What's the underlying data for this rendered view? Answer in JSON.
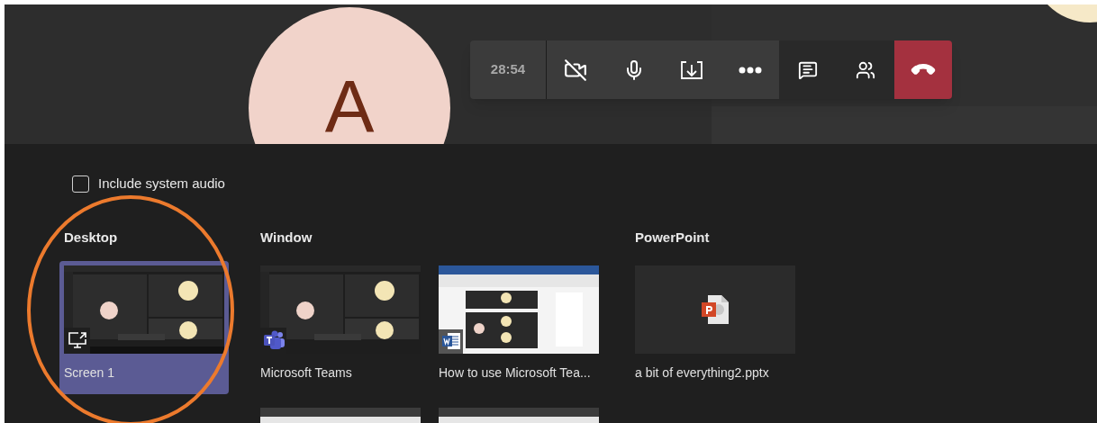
{
  "stage": {
    "avatar_initial": "A"
  },
  "call_toolbar": {
    "timer": "28:54",
    "camera_on": false,
    "mic_on": true
  },
  "share_panel": {
    "system_audio": {
      "label": "Include system audio",
      "checked": false
    },
    "sections": [
      {
        "title": "Desktop",
        "items": [
          {
            "kind": "screen",
            "label": "Screen 1",
            "selected": true
          }
        ]
      },
      {
        "title": "Window",
        "items": [
          {
            "kind": "teams",
            "label": "Microsoft Teams",
            "selected": false
          },
          {
            "kind": "word",
            "label": "How to use Microsoft Tea...",
            "selected": false
          },
          {
            "kind": "browser",
            "selected": false
          },
          {
            "kind": "browser",
            "selected": false
          }
        ]
      },
      {
        "title": "PowerPoint",
        "items": [
          {
            "kind": "powerpoint",
            "label": "a bit of everything2.pptx",
            "selected": false
          }
        ]
      }
    ]
  }
}
